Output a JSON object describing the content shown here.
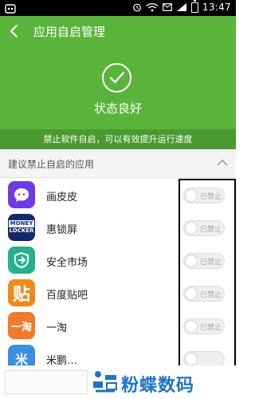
{
  "status_bar": {
    "time": "13:47"
  },
  "header": {
    "title": "应用自启管理",
    "status": "状态良好",
    "tip": "禁止软件自启，可以有效提升运行速度"
  },
  "section": {
    "title": "建议禁止自启的应用"
  },
  "apps": [
    {
      "name": "画皮皮",
      "toggle": "已禁止",
      "icon": "huapipi-icon",
      "icon_color": "#6c3ce0",
      "icon_text": ""
    },
    {
      "name": "惠锁屏",
      "toggle": "已禁止",
      "icon": "moneylocker-icon",
      "icon_color": "#13296b",
      "icon_text": "MONEY LOCKER"
    },
    {
      "name": "安全市场",
      "toggle": "已禁止",
      "icon": "security-market-icon",
      "icon_color": "#27b08d",
      "icon_text": ""
    },
    {
      "name": "百度贴吧",
      "toggle": "已禁止",
      "icon": "baidu-tieba-icon",
      "icon_color": "#ef8a1a",
      "icon_text": "贴"
    },
    {
      "name": "一淘",
      "toggle": "已禁止",
      "icon": "yitao-icon",
      "icon_color": "#f07a2a",
      "icon_text": "一淘"
    },
    {
      "name": "米鹏…",
      "toggle": "",
      "icon": "app-icon",
      "icon_color": "#3a8fe0",
      "icon_text": "米"
    }
  ],
  "watermark": {
    "text": "粉蝶数码"
  },
  "colors": {
    "header_green": "#5ab43b",
    "tip_green": "#4a9a2f",
    "watermark_blue": "#1f73c4"
  }
}
